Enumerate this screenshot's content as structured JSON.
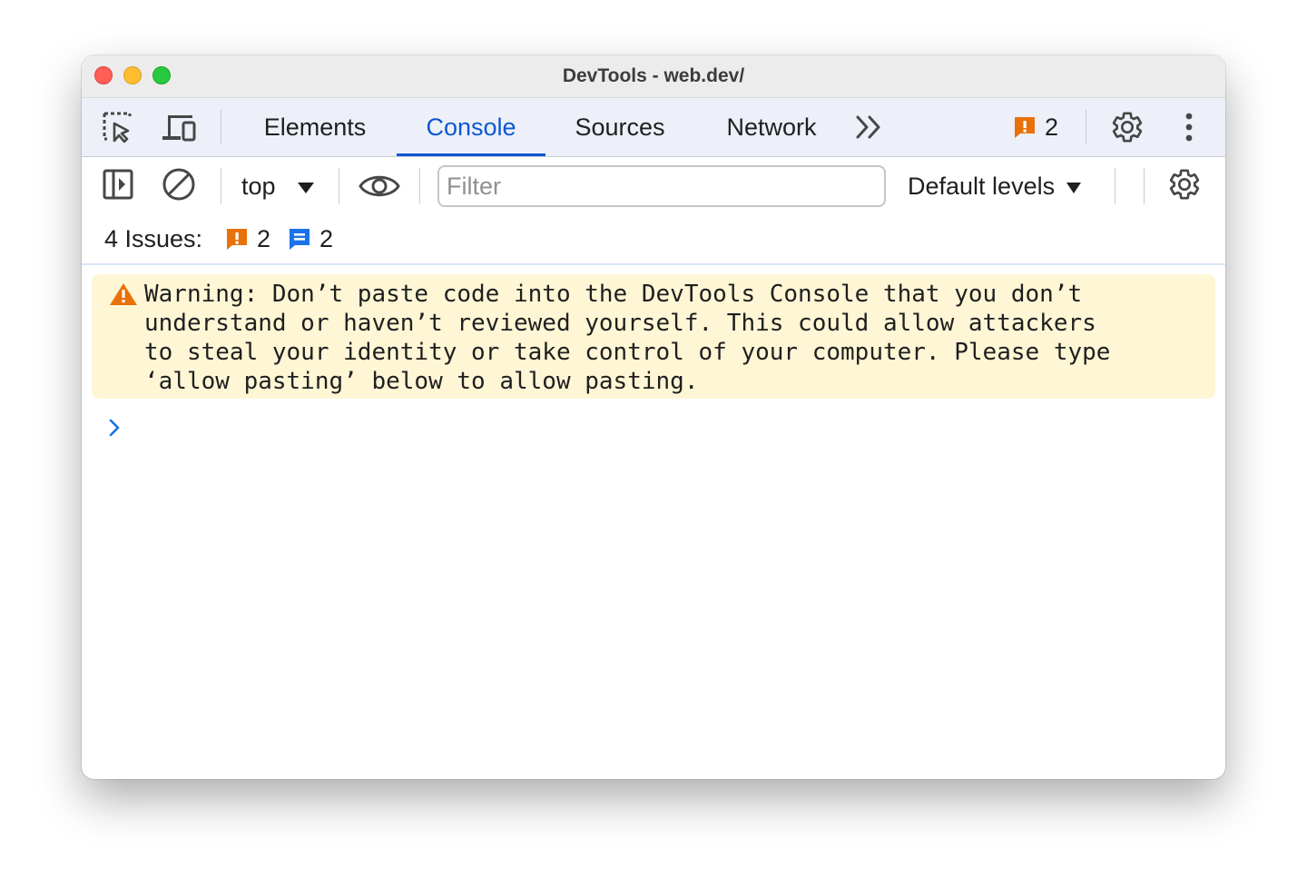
{
  "window": {
    "title": "DevTools - web.dev/"
  },
  "tabbar": {
    "icons": [
      "inspect-element-icon",
      "device-toolbar-icon"
    ],
    "tabs": [
      {
        "label": "Elements",
        "active": false
      },
      {
        "label": "Console",
        "active": true
      },
      {
        "label": "Sources",
        "active": false
      },
      {
        "label": "Network",
        "active": false
      }
    ],
    "more_tabs_icon": "chevron-double-right-icon",
    "issues_badge": {
      "icon": "issue-warning-icon",
      "count": "2"
    },
    "settings_icon": "gear-icon",
    "menu_icon": "kebab-menu-icon"
  },
  "console_toolbar": {
    "sidebar_icon": "sidebar-toggle-icon",
    "clear_icon": "clear-console-icon",
    "context": "top",
    "live_expression_icon": "eye-icon",
    "filter_placeholder": "Filter",
    "filter_value": "",
    "levels": "Default levels",
    "settings_icon": "gear-icon"
  },
  "issues_bar": {
    "label": "4 Issues:",
    "warning_count": "2",
    "info_count": "2"
  },
  "console": {
    "warning_message": "Warning: Don’t paste code into the DevTools Console that you don’t\nunderstand or haven’t reviewed yourself. This could allow attackers\nto steal your identity or take control of your computer. Please type\n‘allow pasting’ below to allow pasting.",
    "prompt_icon": "chevron-right-icon"
  },
  "colors": {
    "accent": "#0b57d0",
    "warning_bg": "#fef6d5",
    "warning_icon": "#e8710a",
    "info_icon": "#1a73e8",
    "tabbar_bg": "#edf0f9"
  }
}
